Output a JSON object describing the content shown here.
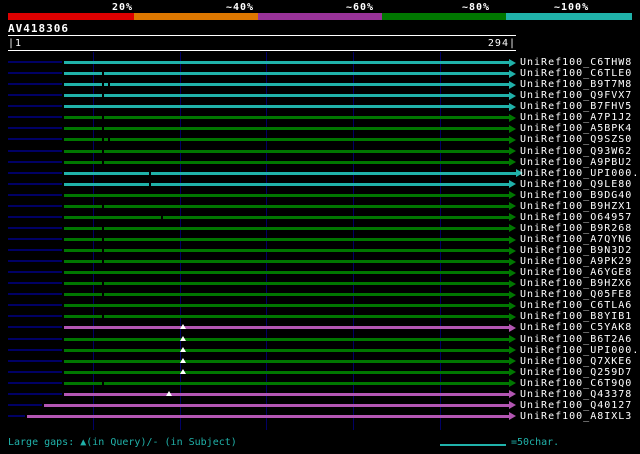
{
  "title": "AV418306",
  "scale_bar": {
    "segments": [
      {
        "label": "20%",
        "color": "#dd0000"
      },
      {
        "label": "~40%",
        "color": "#dd7700"
      },
      {
        "label": "~60%",
        "color": "#993399"
      },
      {
        "label": "~80%",
        "color": "#007700"
      },
      {
        "label": "~100%",
        "color": "#20b2aa"
      }
    ]
  },
  "ruler": {
    "start_label": "|1",
    "end_label": "294|"
  },
  "legend": {
    "large_gaps": "Large gaps: ▲(in Query)/- (in Subject)",
    "scale_label": "=50char."
  },
  "colors": {
    "red": "#dd0000",
    "orange": "#dd7700",
    "purple": "#993399",
    "green": "#007700",
    "cyan": "#20b2aa",
    "magenta": "#b356b3",
    "navy_leader": "#000066",
    "grid": "#000066",
    "subject_gap_tick": "#000000",
    "query_gap_triangle": "#ffffff"
  },
  "chart_data": {
    "type": "bar",
    "title": "AV418306",
    "xlabel": "",
    "ylabel": "",
    "x_range": [
      1,
      294
    ],
    "grid_interval": 50,
    "identity_bands": {
      "cyan": "~100%",
      "green": "~80%",
      "magenta": "~60%"
    },
    "rows": [
      {
        "label": "UniRef100_C6THW8",
        "band": "cyan",
        "start": 33,
        "end": 290,
        "subject_gaps": [],
        "query_gaps": []
      },
      {
        "label": "UniRef100_C6TLE0",
        "band": "cyan",
        "start": 33,
        "end": 290,
        "subject_gaps": [
          56
        ],
        "query_gaps": []
      },
      {
        "label": "UniRef100_B9T7M8",
        "band": "cyan",
        "start": 33,
        "end": 290,
        "subject_gaps": [
          56,
          59
        ],
        "query_gaps": []
      },
      {
        "label": "UniRef100_Q9FVX7",
        "band": "cyan",
        "start": 33,
        "end": 290,
        "subject_gaps": [
          56
        ],
        "query_gaps": []
      },
      {
        "label": "UniRef100_B7FHV5",
        "band": "cyan",
        "start": 33,
        "end": 290,
        "subject_gaps": [],
        "query_gaps": []
      },
      {
        "label": "UniRef100_A7P1J2",
        "band": "green",
        "start": 33,
        "end": 290,
        "subject_gaps": [
          56
        ],
        "query_gaps": []
      },
      {
        "label": "UniRef100_A5BPK4",
        "band": "green",
        "start": 33,
        "end": 290,
        "subject_gaps": [
          56
        ],
        "query_gaps": []
      },
      {
        "label": "UniRef100_Q9SZS0",
        "band": "green",
        "start": 33,
        "end": 290,
        "subject_gaps": [
          56,
          59
        ],
        "query_gaps": []
      },
      {
        "label": "UniRef100_Q93W62",
        "band": "green",
        "start": 33,
        "end": 290,
        "subject_gaps": [
          56
        ],
        "query_gaps": []
      },
      {
        "label": "UniRef100_A9PBU2",
        "band": "green",
        "start": 33,
        "end": 290,
        "subject_gaps": [
          56
        ],
        "query_gaps": []
      },
      {
        "label": "UniRef100_UPI000..",
        "band": "cyan",
        "start": 33,
        "end": 294,
        "subject_gaps": [
          83
        ],
        "query_gaps": []
      },
      {
        "label": "UniRef100_Q9LE80",
        "band": "cyan",
        "start": 33,
        "end": 290,
        "subject_gaps": [
          83
        ],
        "query_gaps": []
      },
      {
        "label": "UniRef100_B9DG40",
        "band": "green",
        "start": 33,
        "end": 290,
        "subject_gaps": [],
        "query_gaps": []
      },
      {
        "label": "UniRef100_B9HZX1",
        "band": "green",
        "start": 33,
        "end": 290,
        "subject_gaps": [
          56
        ],
        "query_gaps": []
      },
      {
        "label": "UniRef100_O64957",
        "band": "green",
        "start": 33,
        "end": 290,
        "subject_gaps": [
          90
        ],
        "query_gaps": []
      },
      {
        "label": "UniRef100_B9R268",
        "band": "green",
        "start": 33,
        "end": 290,
        "subject_gaps": [
          56
        ],
        "query_gaps": []
      },
      {
        "label": "UniRef100_A7QYN6",
        "band": "green",
        "start": 33,
        "end": 290,
        "subject_gaps": [
          56
        ],
        "query_gaps": []
      },
      {
        "label": "UniRef100_B9N3D2",
        "band": "green",
        "start": 33,
        "end": 290,
        "subject_gaps": [
          56
        ],
        "query_gaps": []
      },
      {
        "label": "UniRef100_A9PK29",
        "band": "green",
        "start": 33,
        "end": 290,
        "subject_gaps": [
          56
        ],
        "query_gaps": []
      },
      {
        "label": "UniRef100_A6YGE8",
        "band": "green",
        "start": 33,
        "end": 290,
        "subject_gaps": [],
        "query_gaps": []
      },
      {
        "label": "UniRef100_B9HZX6",
        "band": "green",
        "start": 33,
        "end": 290,
        "subject_gaps": [
          56
        ],
        "query_gaps": []
      },
      {
        "label": "UniRef100_Q05FE8",
        "band": "green",
        "start": 33,
        "end": 290,
        "subject_gaps": [
          56
        ],
        "query_gaps": []
      },
      {
        "label": "UniRef100_C6TLA6",
        "band": "green",
        "start": 33,
        "end": 290,
        "subject_gaps": [],
        "query_gaps": []
      },
      {
        "label": "UniRef100_B8YIB1",
        "band": "green",
        "start": 33,
        "end": 290,
        "subject_gaps": [
          56
        ],
        "query_gaps": []
      },
      {
        "label": "UniRef100_C5YAK8",
        "band": "magenta",
        "start": 33,
        "end": 290,
        "subject_gaps": [],
        "query_gaps": [
          102
        ]
      },
      {
        "label": "UniRef100_B6T2A6",
        "band": "green",
        "start": 33,
        "end": 290,
        "subject_gaps": [],
        "query_gaps": [
          102
        ]
      },
      {
        "label": "UniRef100_UPI000..",
        "band": "green",
        "start": 33,
        "end": 290,
        "subject_gaps": [],
        "query_gaps": [
          102
        ]
      },
      {
        "label": "UniRef100_Q7XKE6",
        "band": "green",
        "start": 33,
        "end": 290,
        "subject_gaps": [],
        "query_gaps": [
          102
        ]
      },
      {
        "label": "UniRef100_Q259D7",
        "band": "green",
        "start": 33,
        "end": 290,
        "subject_gaps": [],
        "query_gaps": [
          102
        ]
      },
      {
        "label": "UniRef100_C6T9Q0",
        "band": "green",
        "start": 33,
        "end": 290,
        "subject_gaps": [
          56
        ],
        "query_gaps": []
      },
      {
        "label": "UniRef100_Q43378",
        "band": "magenta",
        "start": 33,
        "end": 290,
        "subject_gaps": [],
        "query_gaps": [
          94
        ]
      },
      {
        "label": "UniRef100_Q40127",
        "band": "magenta",
        "start": 22,
        "end": 290,
        "subject_gaps": [],
        "query_gaps": []
      },
      {
        "label": "UniRef100_A8IXL3",
        "band": "magenta",
        "start": 12,
        "end": 290,
        "subject_gaps": [],
        "query_gaps": []
      }
    ]
  }
}
